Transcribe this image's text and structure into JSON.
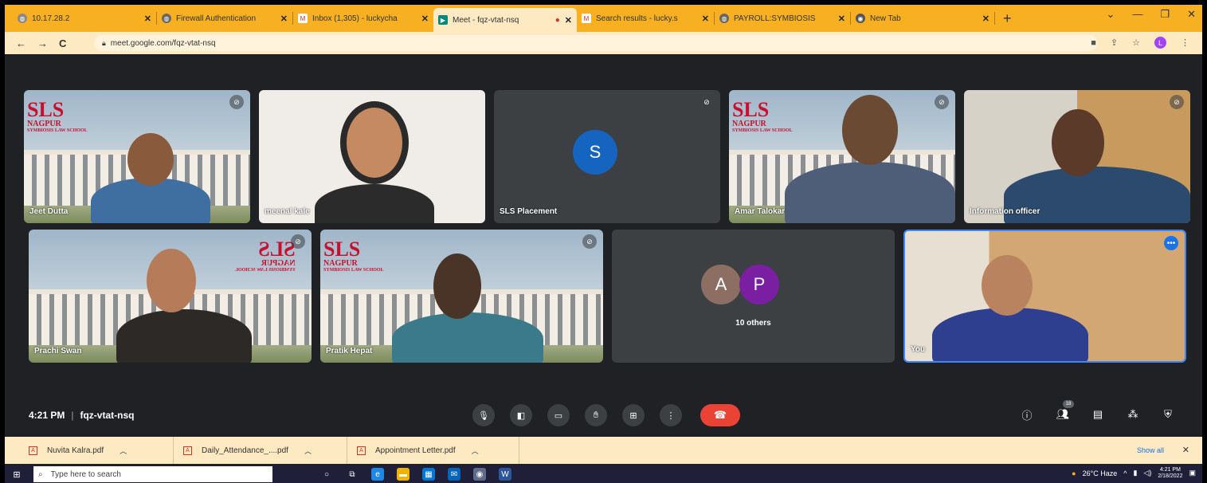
{
  "browser": {
    "tabs": [
      {
        "title": "10.17.28.2",
        "icon": "globe-icon"
      },
      {
        "title": "Firewall Authentication",
        "icon": "globe-icon"
      },
      {
        "title": "Inbox (1,305) - luckycha",
        "icon": "gmail-icon"
      },
      {
        "title": "Meet - fqz-vtat-nsq",
        "icon": "meet-icon",
        "active": true
      },
      {
        "title": "Search results - lucky.s",
        "icon": "gmail-icon"
      },
      {
        "title": "PAYROLL:SYMBIOSIS",
        "icon": "globe-icon"
      },
      {
        "title": "New Tab",
        "icon": "chrome-icon"
      }
    ],
    "url": "meet.google.com/fqz-vtat-nsq",
    "profile_initial": "L"
  },
  "meet": {
    "participants": [
      {
        "name": "Jeet Dutta",
        "background": "sls",
        "muted": true
      },
      {
        "name": "meenal kale",
        "background": "plain",
        "muted": false
      },
      {
        "name": "SLS Placement",
        "initial": "S",
        "avatar_color": "#1565c0",
        "muted": true
      },
      {
        "name": "Amar Talokar",
        "background": "sls",
        "muted": true
      },
      {
        "name": "Information officer",
        "background": "office",
        "muted": true
      },
      {
        "name": "Prachi Swan",
        "background": "sls-mirror",
        "muted": true
      },
      {
        "name": "Pratik Hepat",
        "background": "sls",
        "muted": true
      },
      {
        "name": "You",
        "background": "office"
      }
    ],
    "others": {
      "initials": [
        "A",
        "P"
      ],
      "colors": [
        "#8d6e63",
        "#7b1fa2"
      ],
      "label": "10 others"
    },
    "sls_logo": {
      "big": "SLS",
      "city": "NAGPUR",
      "school": "SYMBIOSIS LAW SCHOOL"
    },
    "time": "4:21 PM",
    "meeting_code": "fqz-vtat-nsq",
    "people_count": "18",
    "colors": {
      "bg": "#202124",
      "tile": "#3c4043",
      "hangup": "#ea4335",
      "self_border": "#4285f4"
    }
  },
  "downloads": {
    "items": [
      "Nuvita Kalra.pdf",
      "Daily_Attendance_....pdf",
      "Appointment Letter.pdf"
    ],
    "show_all": "Show all"
  },
  "taskbar": {
    "search_placeholder": "Type here to search",
    "weather": "26°C Haze",
    "clock_time": "4:21 PM",
    "clock_date": "2/18/2022"
  }
}
